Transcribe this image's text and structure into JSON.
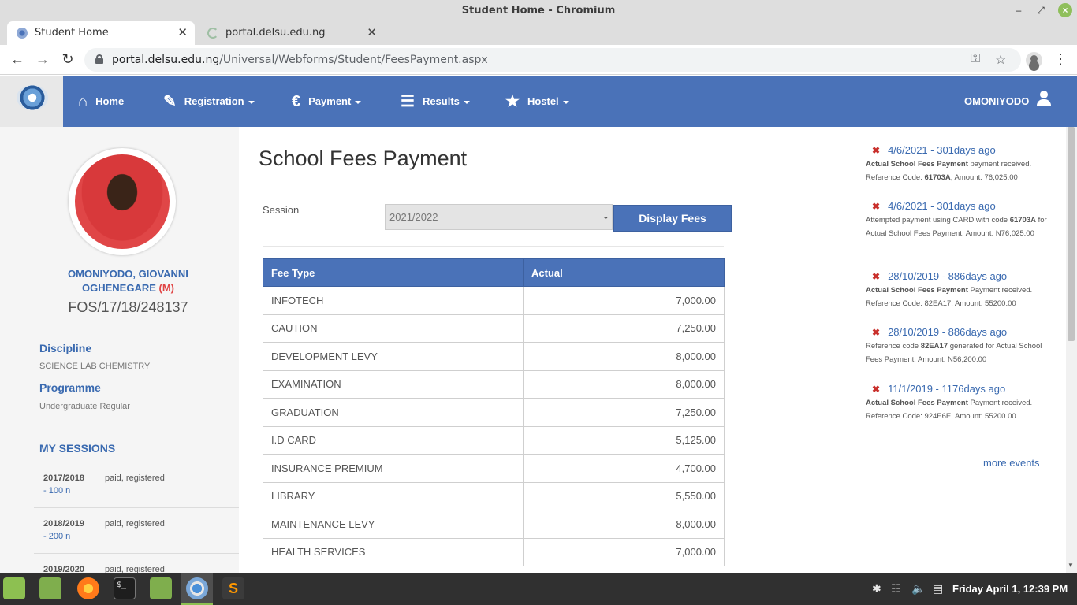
{
  "window": {
    "title": "Student Home - Chromium"
  },
  "tabs": [
    {
      "label": "Student Home",
      "active": true
    },
    {
      "label": "portal.delsu.edu.ng",
      "active": false
    }
  ],
  "address_bar": {
    "domain": "portal.delsu.edu.ng",
    "path": "/Universal/Webforms/Student/FeesPayment.aspx"
  },
  "nav": {
    "items": [
      {
        "label": "Home",
        "icon": "home-icon",
        "has_caret": false
      },
      {
        "label": "Registration",
        "icon": "pencil-icon",
        "has_caret": true
      },
      {
        "label": "Payment",
        "icon": "euro-icon",
        "has_caret": true
      },
      {
        "label": "Results",
        "icon": "list-icon",
        "has_caret": true
      },
      {
        "label": "Hostel",
        "icon": "star-icon",
        "has_caret": true
      }
    ],
    "user": "OMONIYODO",
    "bg_color": "#4a72b8"
  },
  "student": {
    "name": "OMONIYODO, GIOVANNI OGHENEGARE",
    "gender": "(M)",
    "matric": "FOS/17/18/248137",
    "discipline_label": "Discipline",
    "discipline": "SCIENCE LAB CHEMISTRY",
    "programme_label": "Programme",
    "programme": "Undergraduate Regular",
    "sessions_title": "MY SESSIONS",
    "sessions": [
      {
        "year": "2017/2018",
        "status": "paid,  registered",
        "level": "- 100 n"
      },
      {
        "year": "2018/2019",
        "status": "paid,  registered",
        "level": "- 200 n"
      },
      {
        "year": "2019/2020",
        "status": "paid,  registered",
        "level": ""
      }
    ]
  },
  "main": {
    "title": "School Fees Payment",
    "session_label": "Session",
    "session_value": "2021/2022",
    "display_button": "Display Fees",
    "table": {
      "headers": [
        "Fee Type",
        "Actual"
      ],
      "rows": [
        [
          "INFOTECH",
          "7,000.00"
        ],
        [
          "CAUTION",
          "7,250.00"
        ],
        [
          "DEVELOPMENT LEVY",
          "8,000.00"
        ],
        [
          "EXAMINATION",
          "8,000.00"
        ],
        [
          "GRADUATION",
          "7,250.00"
        ],
        [
          "I.D CARD",
          "5,125.00"
        ],
        [
          "INSURANCE PREMIUM",
          "4,700.00"
        ],
        [
          "LIBRARY",
          "5,550.00"
        ],
        [
          "MAINTENANCE LEVY",
          "8,000.00"
        ],
        [
          "HEALTH SERVICES",
          "7,000.00"
        ]
      ]
    }
  },
  "events": [
    {
      "head": "4/6/2021 - 301days ago",
      "body_html_parts": [
        {
          "b": "Actual School Fees Payment"
        },
        {
          "t": " payment received. Reference Code: "
        },
        {
          "b": "61703A"
        },
        {
          "t": ", Amount: 76,025.00"
        }
      ]
    },
    {
      "head": "4/6/2021 - 301days ago",
      "body_html_parts": [
        {
          "t": "Attempted payment using CARD with code "
        },
        {
          "b": "61703A"
        },
        {
          "t": " for Actual School Fees Payment. Amount: N76,025.00"
        }
      ]
    },
    {
      "head": "28/10/2019 - 886days ago",
      "body_html_parts": [
        {
          "b": "Actual School Fees Payment"
        },
        {
          "t": " Payment received. Reference Code: 82EA17, Amount: 55200.00"
        }
      ]
    },
    {
      "head": "28/10/2019 - 886days ago",
      "body_html_parts": [
        {
          "t": "Reference code "
        },
        {
          "b": "82EA17"
        },
        {
          "t": " generated for Actual School Fees Payment. Amount: N56,200.00"
        }
      ]
    },
    {
      "head": "11/1/2019 - 1176days ago",
      "body_html_parts": [
        {
          "b": "Actual School Fees Payment"
        },
        {
          "t": " Payment received. Reference Code: 924E6E, Amount: 55200.00"
        }
      ]
    }
  ],
  "more_events": "more events",
  "taskbar": {
    "clock": "Friday April  1, 12:39 PM"
  }
}
